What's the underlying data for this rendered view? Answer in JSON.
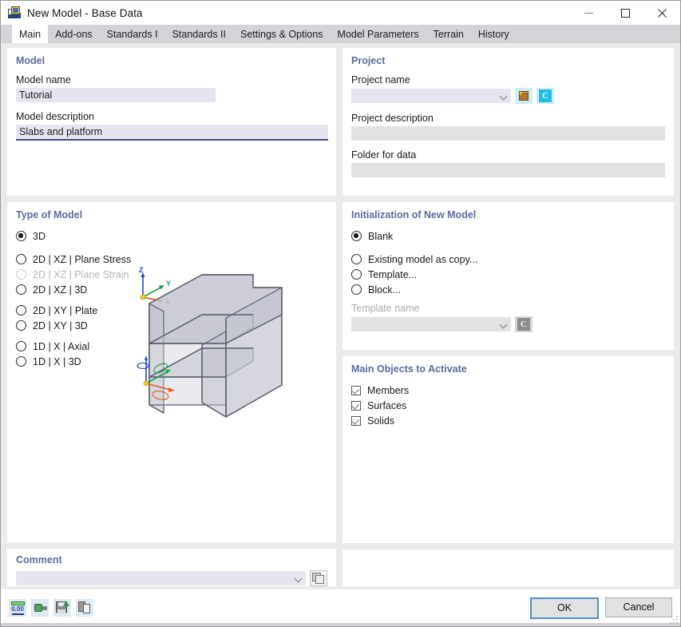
{
  "window": {
    "title": "New Model - Base Data",
    "icon": "new-model-icon",
    "controls": {
      "minimize": "minimize-icon",
      "maximize": "maximize-icon",
      "close": "close-icon"
    }
  },
  "tabs": [
    {
      "label": "Main",
      "selected": true
    },
    {
      "label": "Add-ons",
      "selected": false
    },
    {
      "label": "Standards I",
      "selected": false
    },
    {
      "label": "Standards II",
      "selected": false
    },
    {
      "label": "Settings & Options",
      "selected": false
    },
    {
      "label": "Model Parameters",
      "selected": false
    },
    {
      "label": "Terrain",
      "selected": false
    },
    {
      "label": "History",
      "selected": false
    }
  ],
  "model_panel": {
    "title": "Model",
    "name_label": "Model name",
    "name_value": "Tutorial",
    "description_label": "Model description",
    "description_value": "Slabs and platform",
    "description_focused": true
  },
  "project_panel": {
    "title": "Project",
    "name_label": "Project name",
    "name_value": "",
    "description_label": "Project description",
    "description_value": "",
    "folder_label": "Folder for data",
    "folder_value": "",
    "buttons": [
      {
        "name": "project-browse-icon",
        "glyph": "package-star-icon"
      },
      {
        "name": "project-cloud-icon",
        "glyph": "C"
      }
    ]
  },
  "type_of_model": {
    "title": "Type of Model",
    "options": [
      {
        "label": "3D",
        "checked": true,
        "disabled": false
      },
      {
        "label": "2D | XZ | Plane Stress",
        "checked": false,
        "disabled": false
      },
      {
        "label": "2D | XZ | Plane Strain",
        "checked": false,
        "disabled": true
      },
      {
        "label": "2D | XZ | 3D",
        "checked": false,
        "disabled": false
      },
      {
        "label": "2D | XY | Plate",
        "checked": false,
        "disabled": false
      },
      {
        "label": "2D | XY | 3D",
        "checked": false,
        "disabled": false
      },
      {
        "label": "1D | X | Axial",
        "checked": false,
        "disabled": false
      },
      {
        "label": "1D | X | 3D",
        "checked": false,
        "disabled": false
      }
    ],
    "axis_labels": {
      "x": "X",
      "y": "Y",
      "z": "Z"
    },
    "axis_colors": {
      "x": "#e03c1e",
      "y": "#16a34a",
      "z": "#2244cc",
      "origin": "#f5d020"
    },
    "preview": "3d-model-preview"
  },
  "initialization": {
    "title": "Initialization of New Model",
    "options": [
      {
        "label": "Blank",
        "checked": true
      },
      {
        "label": "Existing model as copy...",
        "checked": false
      },
      {
        "label": "Template...",
        "checked": false
      },
      {
        "label": "Block...",
        "checked": false
      }
    ],
    "template_label": "Template name",
    "template_value": "",
    "template_disabled": true,
    "template_button": "C"
  },
  "main_objects": {
    "title": "Main Objects to Activate",
    "items": [
      {
        "label": "Members",
        "checked": true
      },
      {
        "label": "Surfaces",
        "checked": true
      },
      {
        "label": "Solids",
        "checked": true
      }
    ]
  },
  "comment_panel": {
    "title": "Comment",
    "value": "",
    "button": "comment-library-icon"
  },
  "footer": {
    "tools": [
      {
        "name": "units-icon",
        "label": "0,00"
      },
      {
        "name": "green-object-icon",
        "label": ""
      },
      {
        "name": "save-defaults-icon",
        "label": ""
      },
      {
        "name": "copy-documents-icon",
        "label": ""
      }
    ],
    "ok_label": "OK",
    "cancel_label": "Cancel"
  },
  "colors": {
    "accent_header": "#5b6ba0",
    "input_bg": "#e6e6f0",
    "input_bg_disabled": "#e2e2e2",
    "dialog_bg": "#eceaea",
    "default_button_border": "#4f90d0"
  }
}
